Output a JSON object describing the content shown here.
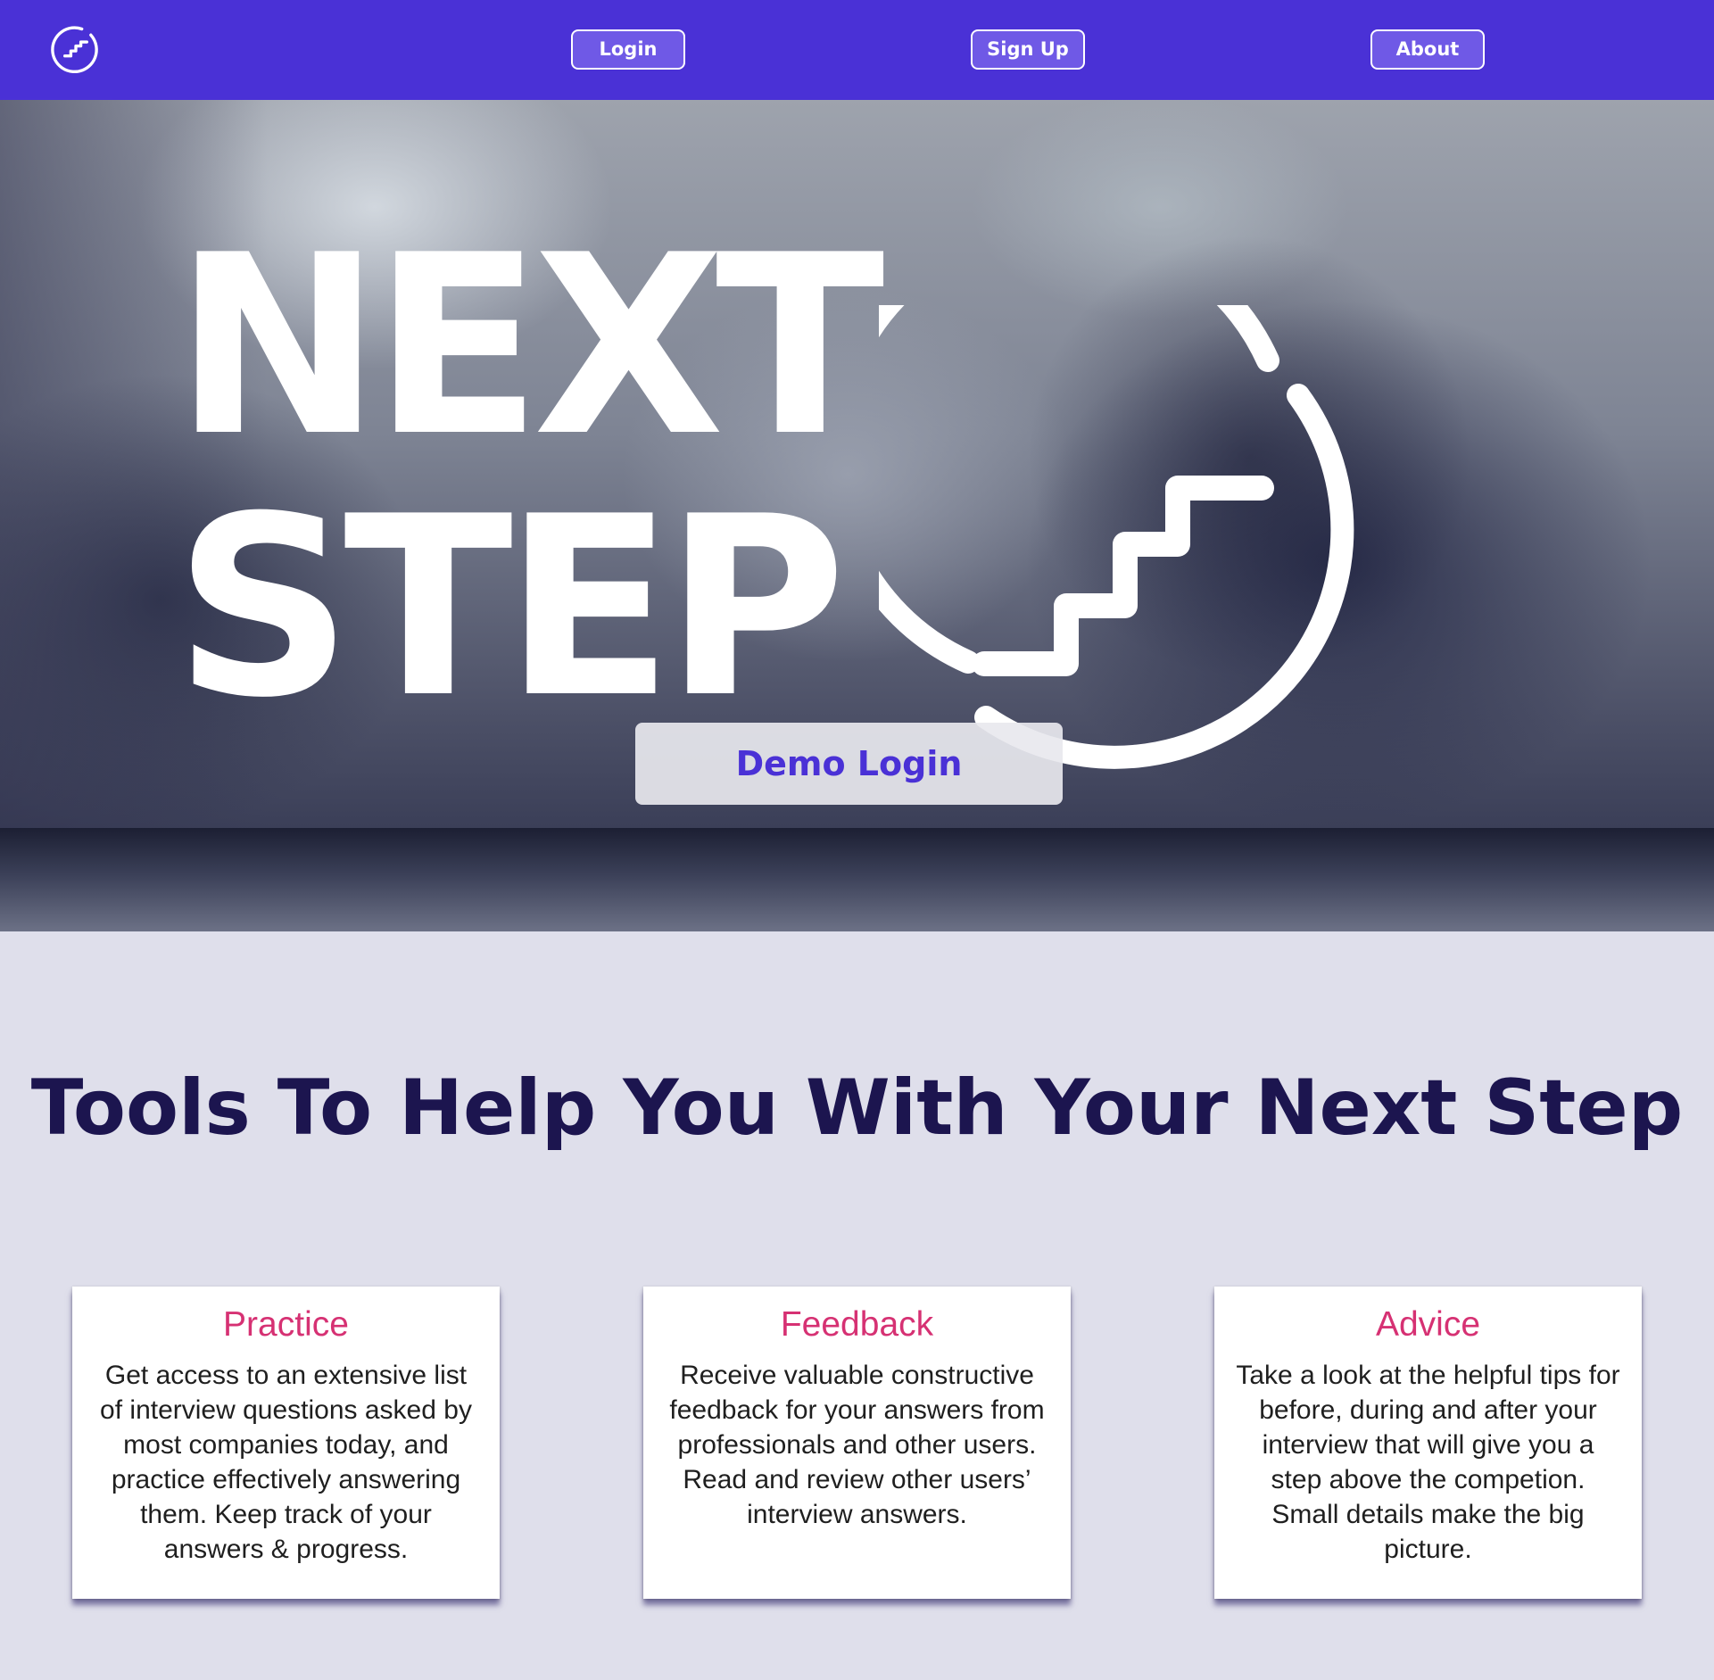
{
  "nav": {
    "logo_icon": "stairs-circle-icon",
    "login_label": "Login",
    "signup_label": "Sign Up",
    "about_label": "About",
    "bg_color": "#4a31d6"
  },
  "hero": {
    "title_line1": "NEXT",
    "title_line2": "STEP",
    "logo_icon": "stairs-circle-icon",
    "demo_button_label": "Demo Login"
  },
  "tools": {
    "heading": "Tools To Help You With Your Next Step",
    "cards": [
      {
        "title": "Practice",
        "text": "Get access to an extensive list of interview questions asked by most companies today, and practice effectively answering them. Keep track of your answers & progress."
      },
      {
        "title": "Feedback",
        "text": "Receive valuable constructive feedback for your answers from professionals and other users. Read and review other users’ interview answers."
      },
      {
        "title": "Advice",
        "text": "Take a look at the helpful tips for before, during and after your interview that will give you a step above the competion. Small details make the big picture."
      }
    ]
  },
  "colors": {
    "accent": "#4a31d6",
    "card_title": "#d63173",
    "heading": "#1c154f",
    "page_bg": "#dfdfeb"
  }
}
